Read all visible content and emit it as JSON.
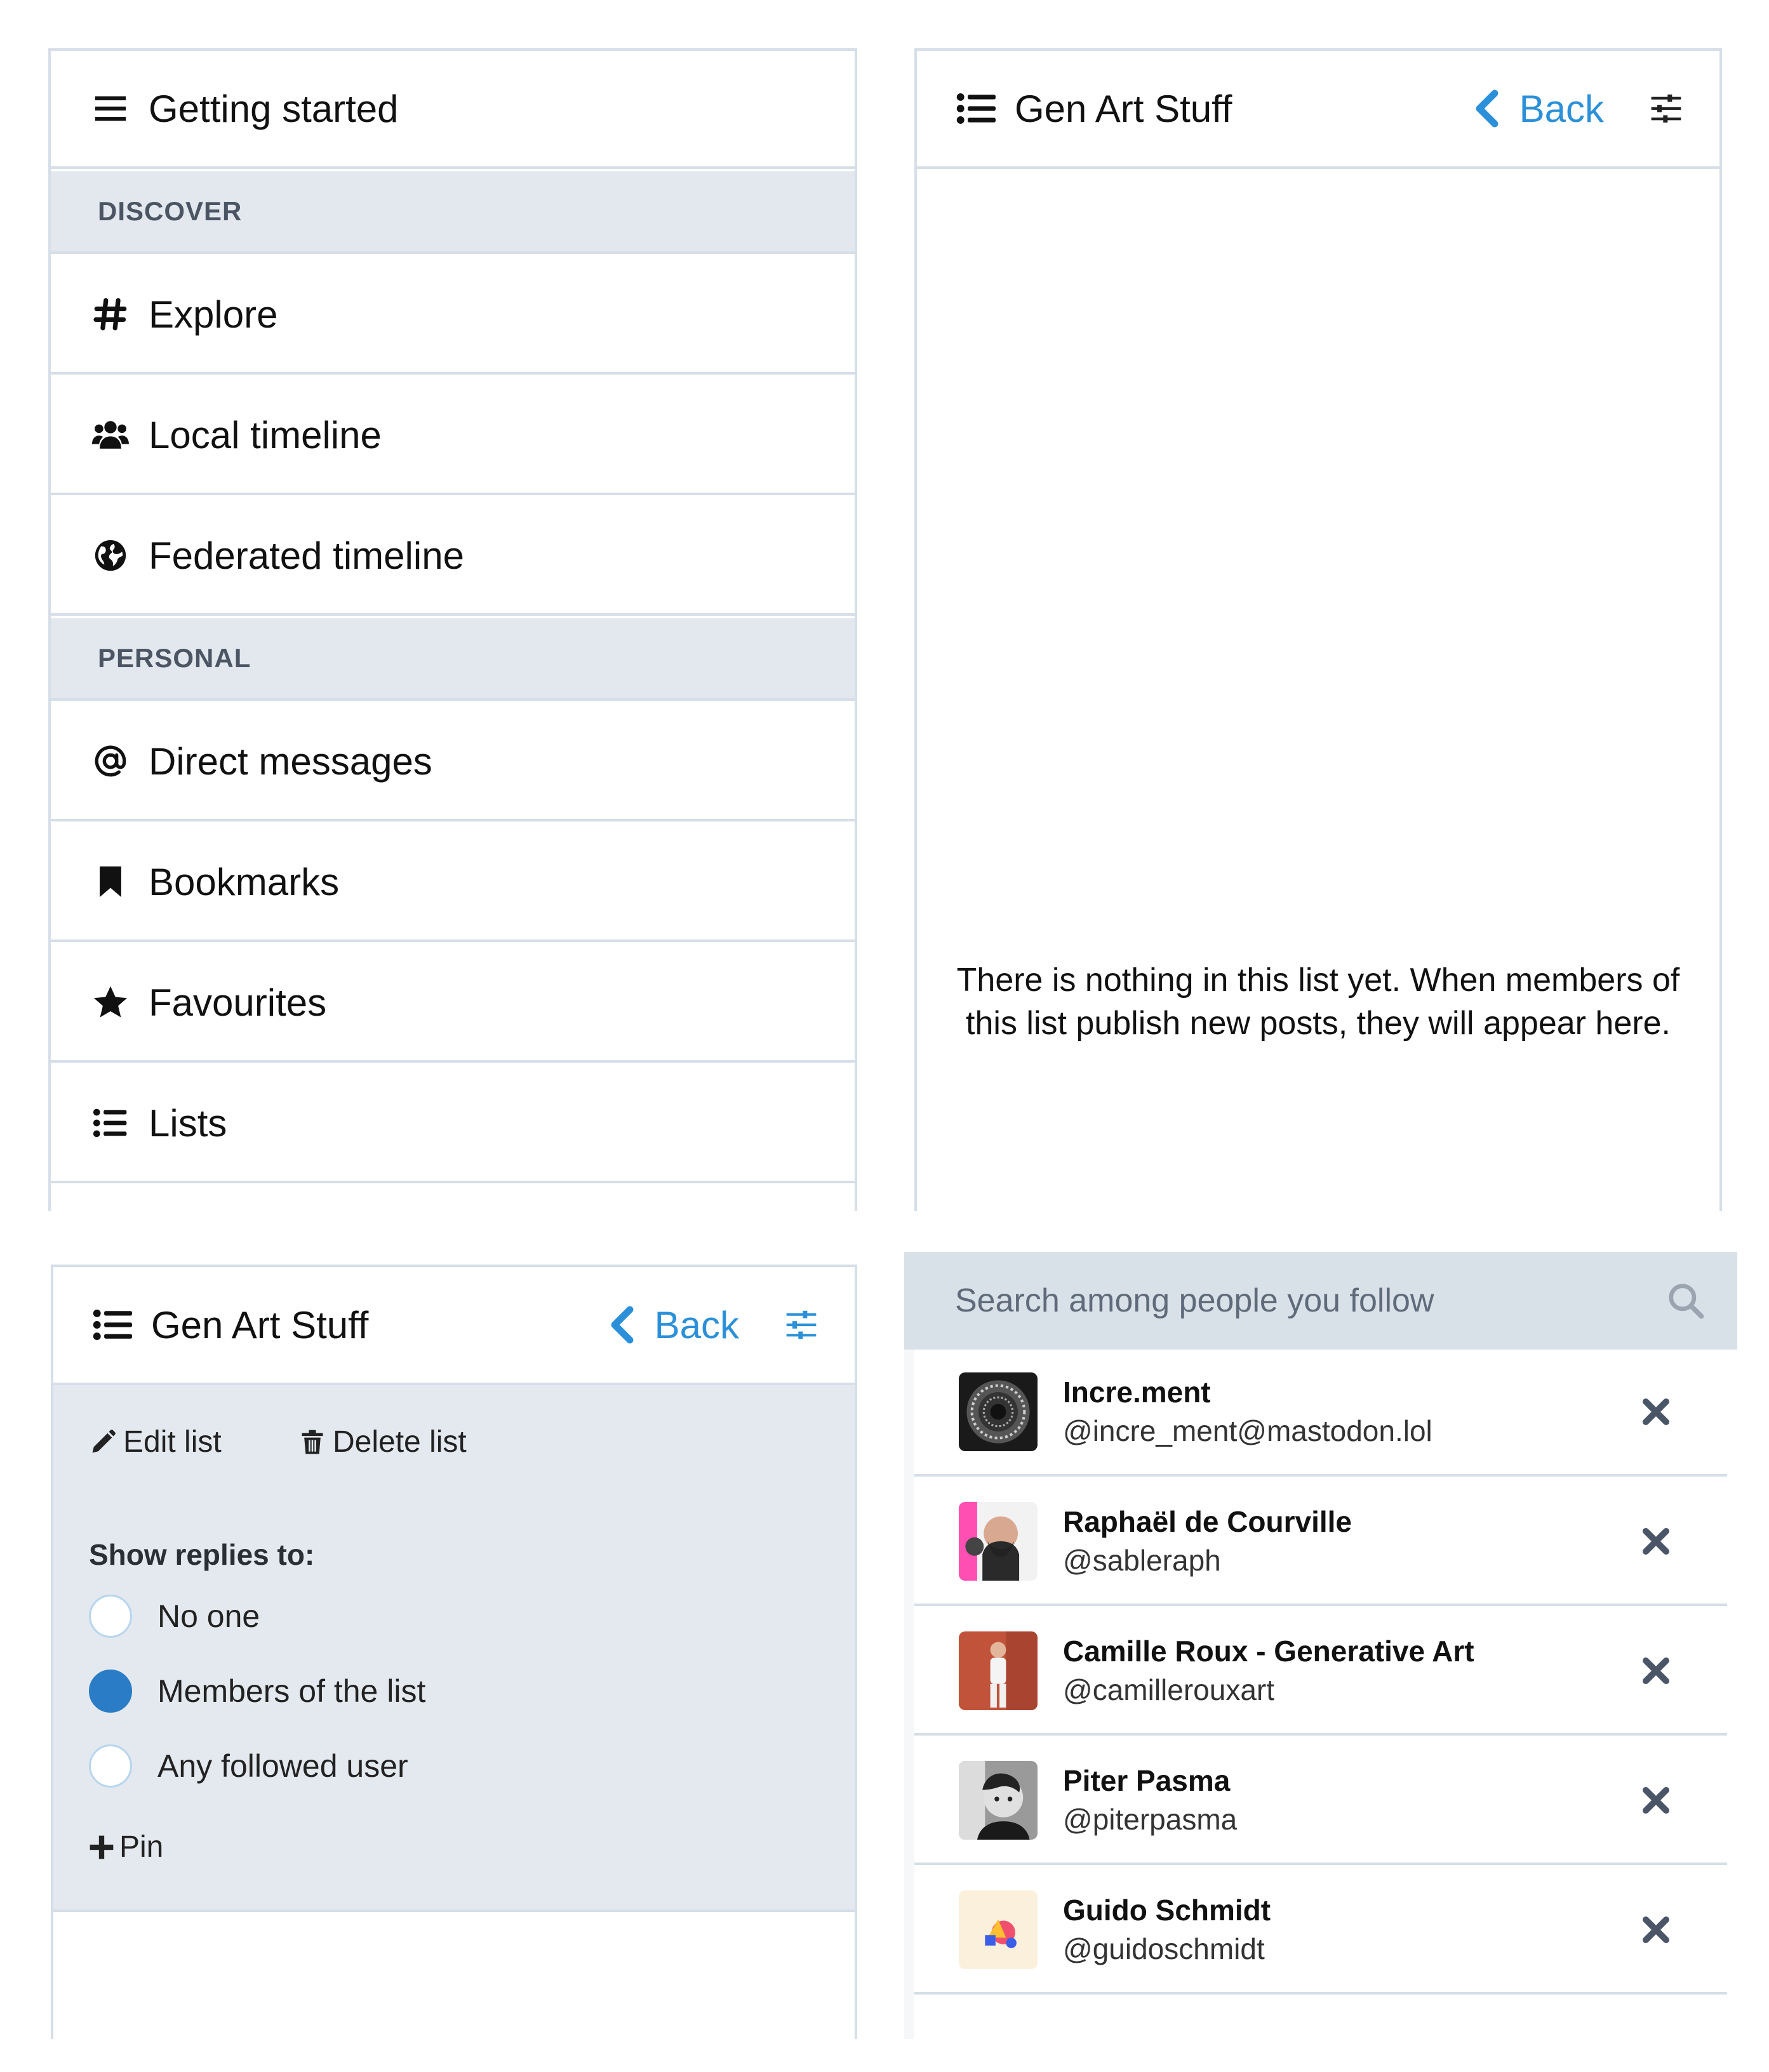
{
  "nav": {
    "getting_started": "Getting started",
    "discover_heading": "DISCOVER",
    "explore": "Explore",
    "local_timeline": "Local timeline",
    "federated_timeline": "Federated timeline",
    "personal_heading": "PERSONAL",
    "direct_messages": "Direct messages",
    "bookmarks": "Bookmarks",
    "favourites": "Favourites",
    "lists": "Lists"
  },
  "list_column": {
    "title": "Gen Art Stuff",
    "back_label": "Back",
    "empty_message": "There is nothing in this list yet. When members of this list publish new posts, they will appear here."
  },
  "list_settings": {
    "edit_list": "Edit list",
    "delete_list": "Delete list",
    "show_replies_label": "Show replies to:",
    "options": [
      {
        "label": "No one",
        "checked": false
      },
      {
        "label": "Members of the list",
        "checked": true
      },
      {
        "label": "Any followed user",
        "checked": false
      }
    ],
    "pin_label": "Pin"
  },
  "members": {
    "search_placeholder": "Search among people you follow",
    "items": [
      {
        "name": "Incre.ment",
        "handle": "@incre_ment@mastodon.lol"
      },
      {
        "name": "Raphaël de Courville",
        "handle": "@sableraph"
      },
      {
        "name": "Camille Roux - Generative Art",
        "handle": "@camillerouxart"
      },
      {
        "name": "Piter Pasma",
        "handle": "@piterpasma"
      },
      {
        "name": "Guido Schmidt",
        "handle": "@guidoschmidt"
      }
    ]
  },
  "colors": {
    "accent": "#2b90d9",
    "border": "#d6dee8",
    "section_bg": "#e3e8ee",
    "settings_bg": "#e4e9ef",
    "search_bg": "#d9e1e8"
  }
}
